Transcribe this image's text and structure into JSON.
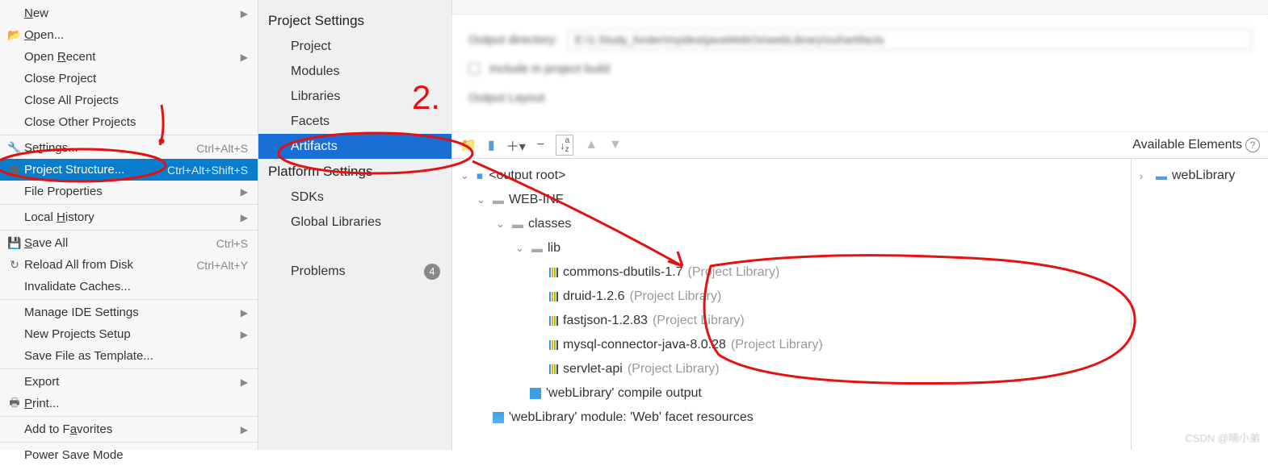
{
  "file_menu": [
    {
      "label": "New",
      "icon": "",
      "shortcut": "",
      "arrow": true,
      "ul": 0
    },
    {
      "label": "Open...",
      "icon": "open",
      "shortcut": "",
      "arrow": false,
      "ul": 0
    },
    {
      "label": "Open Recent",
      "icon": "",
      "shortcut": "",
      "arrow": true,
      "ul": 5
    },
    {
      "label": "Close Project",
      "icon": "",
      "shortcut": "",
      "arrow": false
    },
    {
      "label": "Close All Projects",
      "icon": "",
      "shortcut": "",
      "arrow": false
    },
    {
      "label": "Close Other Projects",
      "icon": "",
      "shortcut": "",
      "arrow": false
    },
    {
      "sep": true
    },
    {
      "label": "Settings...",
      "icon": "wrench",
      "shortcut": "Ctrl+Alt+S",
      "arrow": false,
      "ul": 2
    },
    {
      "label": "Project Structure...",
      "icon": "struct",
      "shortcut": "Ctrl+Alt+Shift+S",
      "arrow": false,
      "selected": true
    },
    {
      "label": "File Properties",
      "icon": "",
      "shortcut": "",
      "arrow": true
    },
    {
      "sep": true
    },
    {
      "label": "Local History",
      "icon": "",
      "shortcut": "",
      "arrow": true,
      "ul": 6
    },
    {
      "sep": true
    },
    {
      "label": "Save All",
      "icon": "save",
      "shortcut": "Ctrl+S",
      "arrow": false,
      "ul": 0
    },
    {
      "label": "Reload All from Disk",
      "icon": "reload",
      "shortcut": "Ctrl+Alt+Y",
      "arrow": false
    },
    {
      "label": "Invalidate Caches...",
      "icon": "",
      "shortcut": "",
      "arrow": false
    },
    {
      "sep": true
    },
    {
      "label": "Manage IDE Settings",
      "icon": "",
      "shortcut": "",
      "arrow": true
    },
    {
      "label": "New Projects Setup",
      "icon": "",
      "shortcut": "",
      "arrow": true
    },
    {
      "label": "Save File as Template...",
      "icon": "",
      "shortcut": "",
      "arrow": false
    },
    {
      "sep": true
    },
    {
      "label": "Export",
      "icon": "",
      "shortcut": "",
      "arrow": true
    },
    {
      "label": "Print...",
      "icon": "print",
      "shortcut": "",
      "arrow": false,
      "ul": 0
    },
    {
      "sep": true
    },
    {
      "label": "Add to Favorites",
      "icon": "",
      "shortcut": "",
      "arrow": true,
      "ul": 8
    },
    {
      "sep": true
    },
    {
      "label": "Power Save Mode",
      "icon": "",
      "shortcut": "",
      "arrow": false
    }
  ],
  "settings": {
    "s1": "Project Settings",
    "project": "Project",
    "modules": "Modules",
    "libraries": "Libraries",
    "facets": "Facets",
    "artifacts": "Artifacts",
    "s2": "Platform Settings",
    "sdks": "SDKs",
    "global": "Global Libraries",
    "problems": "Problems",
    "badge": "4"
  },
  "blur": {
    "outdir_label": "Output directory:",
    "outdir_value": "E:\\1.Study_forder\\myidea\\javaWebOs\\webLibrary\\out\\artifacts",
    "include": "Include in project build",
    "layout": "Output Layout"
  },
  "toolbar": {
    "avail": "Available Elements"
  },
  "tree": {
    "root": "<output root>",
    "webinf": "WEB-INF",
    "classes": "classes",
    "lib": "lib",
    "libs": [
      {
        "name": "commons-dbutils-1.7",
        "suffix": "(Project Library)"
      },
      {
        "name": "druid-1.2.6",
        "suffix": "(Project Library)"
      },
      {
        "name": "fastjson-1.2.83",
        "suffix": "(Project Library)"
      },
      {
        "name": "mysql-connector-java-8.0.28",
        "suffix": "(Project Library)"
      },
      {
        "name": "servlet-api",
        "suffix": "(Project Library)"
      }
    ],
    "compile": "'webLibrary' compile output",
    "facet": "'webLibrary' module: 'Web' facet resources",
    "right": "webLibrary"
  },
  "watermark": "CSDN @喃小弟"
}
